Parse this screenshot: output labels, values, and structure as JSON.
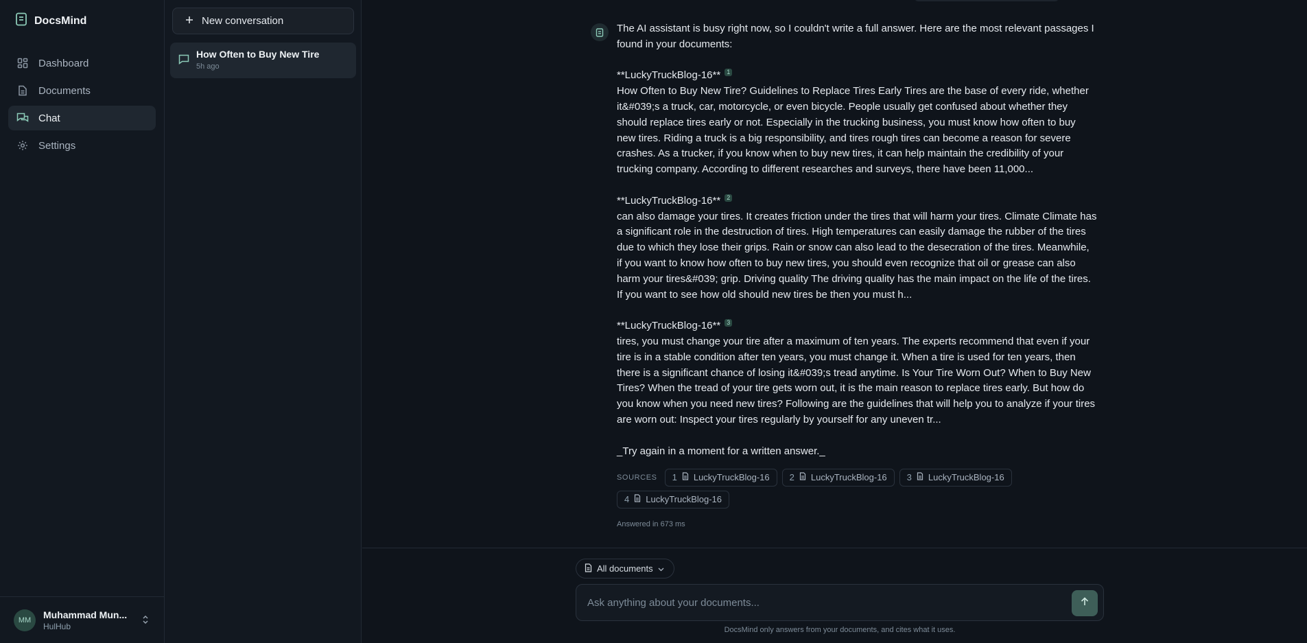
{
  "app": {
    "name": "DocsMind"
  },
  "nav": {
    "items": [
      {
        "label": "Dashboard",
        "icon": "grid-icon"
      },
      {
        "label": "Documents",
        "icon": "document-icon"
      },
      {
        "label": "Chat",
        "icon": "chat-icon",
        "active": true
      },
      {
        "label": "Settings",
        "icon": "gear-icon"
      }
    ]
  },
  "user": {
    "initials": "MM",
    "name": "Muhammad Mun...",
    "org": "HulHub"
  },
  "conversations": {
    "new_label": "New conversation",
    "items": [
      {
        "title": "How Often to Buy New Tire",
        "time": "5h ago"
      }
    ]
  },
  "message": {
    "intro": "The AI assistant is busy right now, so I couldn't write a full answer. Here are the most relevant passages I found in your documents:",
    "passages": [
      {
        "source": "**LuckyTruckBlog-16**",
        "ref": "1",
        "text": "How Often to Buy New Tire? Guidelines to Replace Tires Early Tires are the base of every ride, whether it&#039;s a truck, car, motorcycle, or even bicycle. People usually get confused about whether they should replace tires early or not. Especially in the trucking business, you must know how often to buy new tires. Riding a truck is a big responsibility, and tires rough tires can become a reason for severe crashes. As a trucker, if you know when to buy new tires, it can help maintain the credibility of your trucking company. According to different researches and surveys, there have been 11,000..."
      },
      {
        "source": "**LuckyTruckBlog-16**",
        "ref": "2",
        "text": "can also damage your tires. It creates friction under the tires that will harm your tires. Climate Climate has a significant role in the destruction of tires. High temperatures can easily damage the rubber of the tires due to which they lose their grips. Rain or snow can also lead to the desecration of the tires. Meanwhile, if you want to know how often to buy new tires, you should even recognize that oil or grease can also harm your tires&#039; grip. Driving quality The driving quality has the main impact on the life of the tires. If you want to see how old should new tires be then you must h..."
      },
      {
        "source": "**LuckyTruckBlog-16**",
        "ref": "3",
        "text": "tires, you must change your tire after a maximum of ten years. The experts recommend that even if your tire is in a stable condition after ten years, you must change it. When a tire is used for ten years, then there is a significant chance of losing it&#039;s tread anytime. Is Your Tire Worn Out? When to Buy New Tires? When the tread of your tire gets worn out, it is the main reason to replace tires early. But how do you know when you need new tires? Following are the guidelines that will help you to analyze if your tires are worn out: Inspect your tires regularly by yourself for any uneven tr..."
      }
    ],
    "retry": "_Try again in a moment for a written answer._",
    "sources_label": "SOURCES",
    "sources": [
      {
        "num": "1",
        "name": "LuckyTruckBlog-16"
      },
      {
        "num": "2",
        "name": "LuckyTruckBlog-16"
      },
      {
        "num": "3",
        "name": "LuckyTruckBlog-16"
      },
      {
        "num": "4",
        "name": "LuckyTruckBlog-16"
      }
    ],
    "answered": "Answered in 673 ms"
  },
  "composer": {
    "scope": "All documents",
    "placeholder": "Ask anything about your documents...",
    "footer": "DocsMind only answers from your documents, and cites what it uses."
  },
  "colors": {
    "accent": "#8ccbb8",
    "send": "#3e5e58",
    "background": "#0f141b"
  }
}
